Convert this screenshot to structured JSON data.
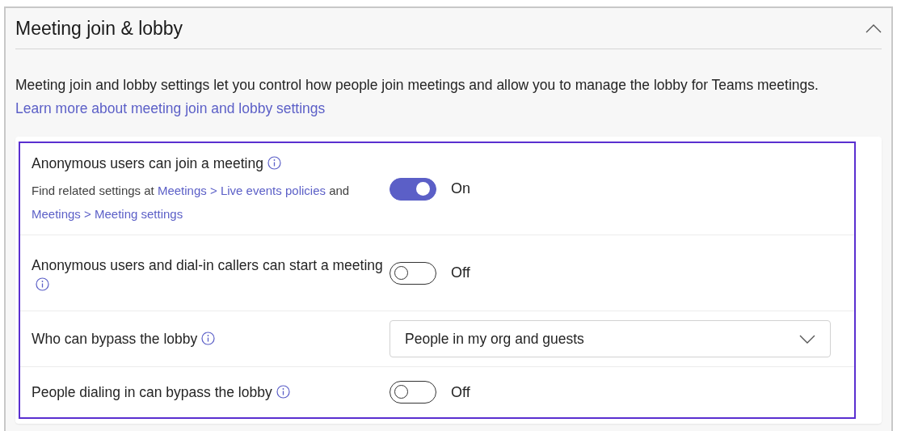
{
  "section": {
    "title": "Meeting join & lobby",
    "expanded": true
  },
  "description": {
    "text": "Meeting join and lobby settings let you control how people join meetings and allow you to manage the lobby for Teams meetings.",
    "link": "Learn more about meeting join and lobby settings"
  },
  "settings": [
    {
      "kind": "toggle",
      "label": "Anonymous users can join a meeting",
      "note": [
        {
          "kind": "text",
          "text": "Find related settings at"
        },
        {
          "kind": "link",
          "text": "Meetings > Live events policies"
        },
        {
          "kind": "text",
          "text": "and"
        },
        {
          "kind": "link",
          "text": "Meetings > Meeting settings"
        }
      ],
      "on": true,
      "state_label": "On"
    },
    {
      "kind": "toggle",
      "label": "Anonymous users and dial-in callers can start a meeting",
      "on": false,
      "state_label": "Off"
    },
    {
      "kind": "dropdown",
      "label": "Who can bypass the lobby",
      "value": "People in my org and guests"
    },
    {
      "kind": "toggle",
      "label": "People dialing in can bypass the lobby",
      "on": false,
      "state_label": "Off"
    }
  ]
}
